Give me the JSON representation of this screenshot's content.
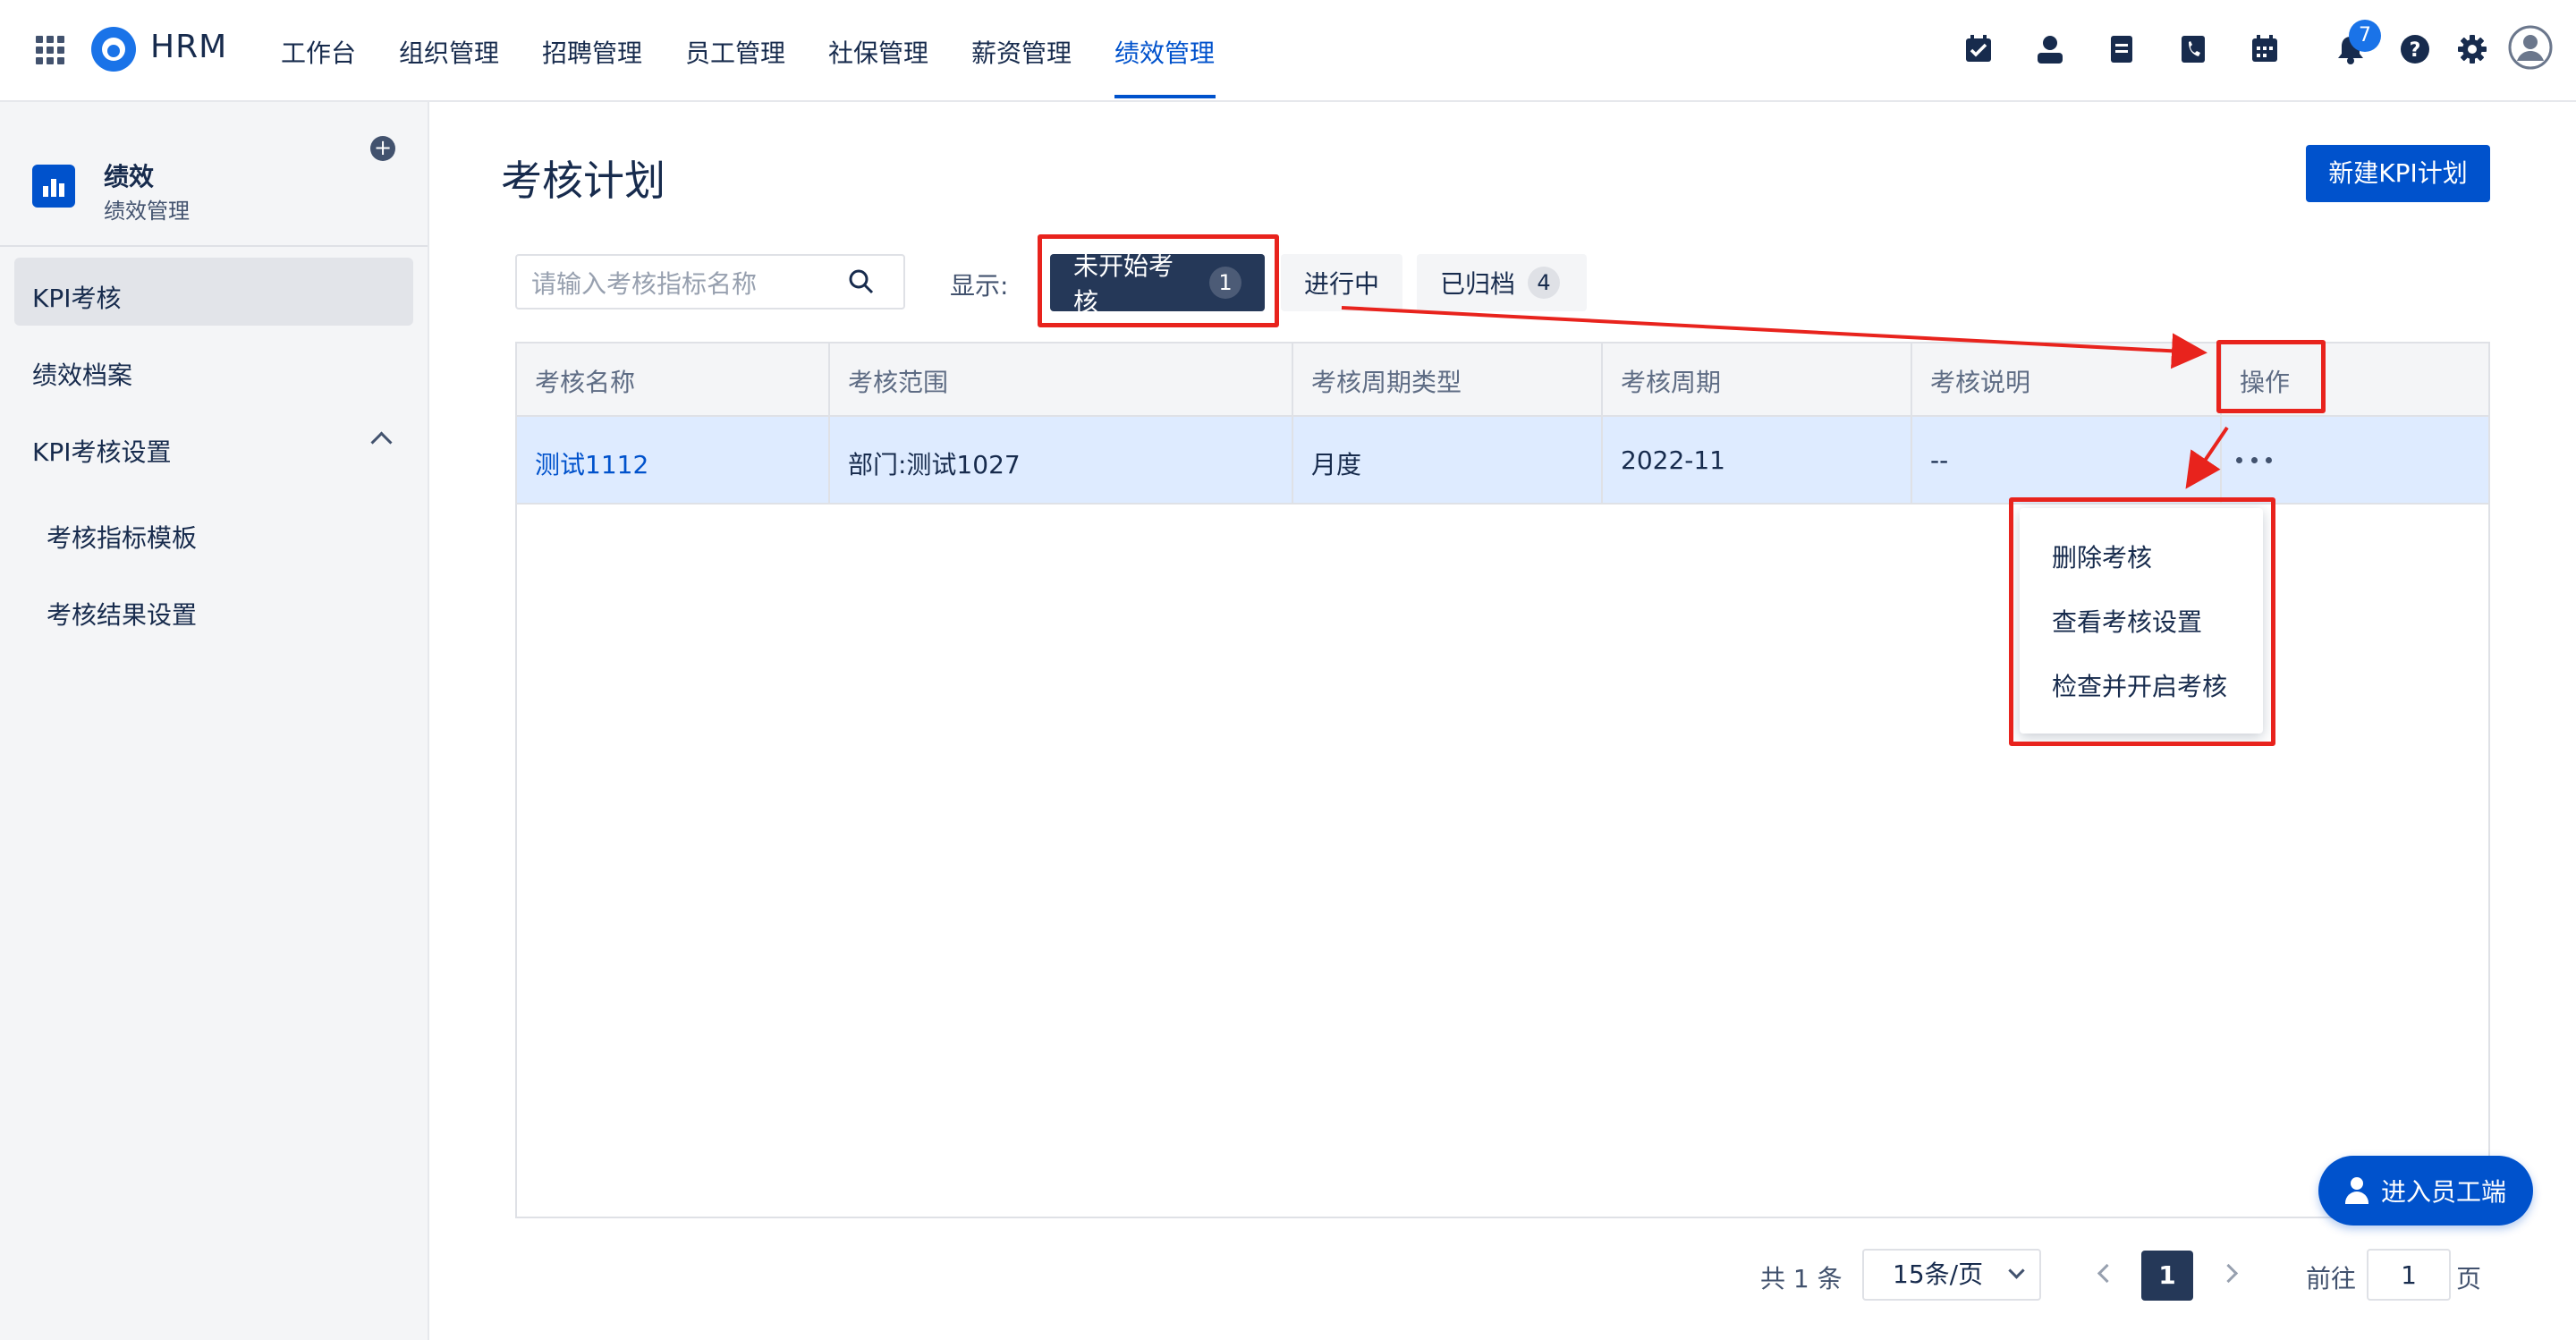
{
  "header": {
    "brand": "HRM",
    "nav": [
      "工作台",
      "组织管理",
      "招聘管理",
      "员工管理",
      "社保管理",
      "薪资管理",
      "绩效管理"
    ],
    "active_nav": "绩效管理",
    "notification_count": "7",
    "icons": [
      "checklist-icon",
      "person-icon",
      "document-icon",
      "phone-book-icon",
      "calendar-icon",
      "bell-icon",
      "help-icon",
      "gear-icon",
      "avatar-icon"
    ]
  },
  "sidebar": {
    "app_title": "绩效",
    "app_subtitle": "绩效管理",
    "items": [
      {
        "label": "KPI考核"
      },
      {
        "label": "绩效档案"
      },
      {
        "label": "KPI考核设置"
      },
      {
        "label": "考核指标模板"
      },
      {
        "label": "考核结果设置"
      }
    ]
  },
  "main": {
    "title": "考核计划",
    "new_button": "新建KPI计划",
    "search": {
      "placeholder": "请输入考核指标名称",
      "value": ""
    },
    "show_label": "显示:",
    "tabs": [
      {
        "label": "未开始考核",
        "count": "1"
      },
      {
        "label": "进行中",
        "count": ""
      },
      {
        "label": "已归档",
        "count": "4"
      }
    ],
    "table": {
      "headers": [
        "考核名称",
        "考核范围",
        "考核周期类型",
        "考核周期",
        "考核说明",
        "操作"
      ],
      "rows": [
        {
          "name": "测试1112",
          "scope": "部门:测试1027",
          "cycle_type": "月度",
          "cycle": "2022-11",
          "note": "--"
        }
      ]
    },
    "menu": [
      "删除考核",
      "查看考核设置",
      "检查并开启考核"
    ]
  },
  "pagination": {
    "total": "共 1 条",
    "page_size": "15条/页",
    "current": "1",
    "goto_label": "前往",
    "goto_value": "1",
    "page_suffix": "页"
  },
  "employee_button": "进入员工端",
  "colors": {
    "accent": "#0052cc",
    "dark": "#253858",
    "annotation": "#e8231d",
    "row_highlight": "#deebff"
  }
}
